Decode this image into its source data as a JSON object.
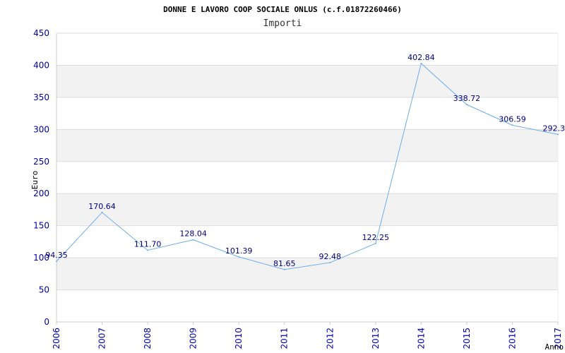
{
  "chart_data": {
    "type": "line",
    "title": "DONNE E LAVORO COOP SOCIALE ONLUS (c.f.01872260466)",
    "subtitle": "Importi",
    "xlabel": "Anno",
    "ylabel": "Euro",
    "categories": [
      "2006",
      "2007",
      "2008",
      "2009",
      "2010",
      "2011",
      "2012",
      "2013",
      "2014",
      "2015",
      "2016",
      "2017"
    ],
    "series": [
      {
        "values": [
          94.35,
          170.64,
          111.7,
          128.04,
          101.39,
          81.65,
          92.48,
          122.25,
          402.84,
          338.72,
          306.59,
          292.3
        ],
        "labels": [
          "94.35",
          "170.64",
          "111.70",
          "128.04",
          "101.39",
          "81.65",
          "92.48",
          "122.25",
          "402.84",
          "338.72",
          "306.59",
          "292.3"
        ]
      }
    ],
    "ylim": [
      0,
      450
    ],
    "yticks": [
      "0",
      "50",
      "100",
      "150",
      "200",
      "250",
      "300",
      "350",
      "400",
      "450"
    ],
    "grid": true,
    "colors": {
      "line": "#6aaee8",
      "band": "#f2f2f2",
      "grid": "#dddddd",
      "ticks": "#0000aa",
      "labels": "#000080"
    }
  }
}
